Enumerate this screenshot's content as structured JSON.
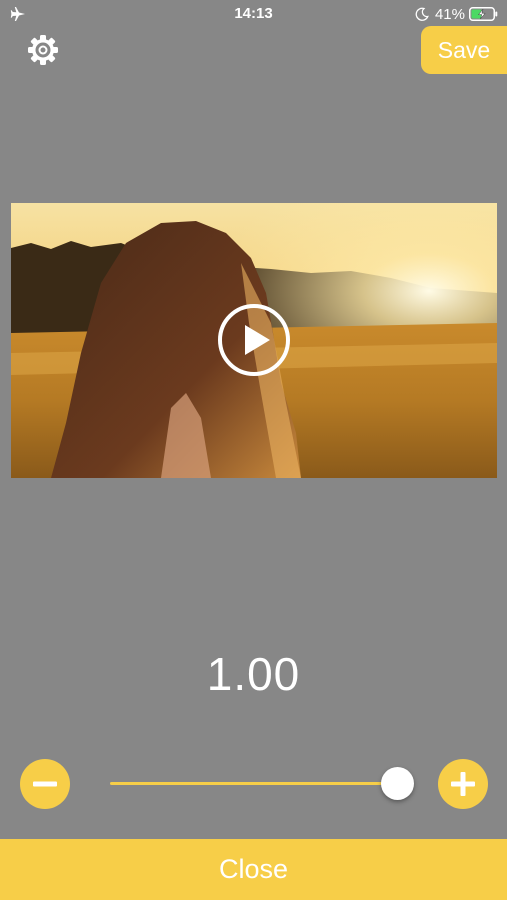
{
  "status_bar": {
    "time": "14:13",
    "battery_percent": "41%",
    "icons": [
      "airplane-icon",
      "moon-icon",
      "battery-charging-icon"
    ]
  },
  "toolbar": {
    "settings_icon": "gear-icon",
    "save_label": "Save"
  },
  "video": {
    "play_icon": "play-icon"
  },
  "speed": {
    "value_label": "1.00",
    "slider_fraction": 0.99,
    "decrease_icon": "minus-icon",
    "increase_icon": "plus-icon"
  },
  "footer": {
    "close_label": "Close"
  },
  "colors": {
    "background": "#878787",
    "accent": "#f7ce48",
    "text": "#ffffff"
  }
}
